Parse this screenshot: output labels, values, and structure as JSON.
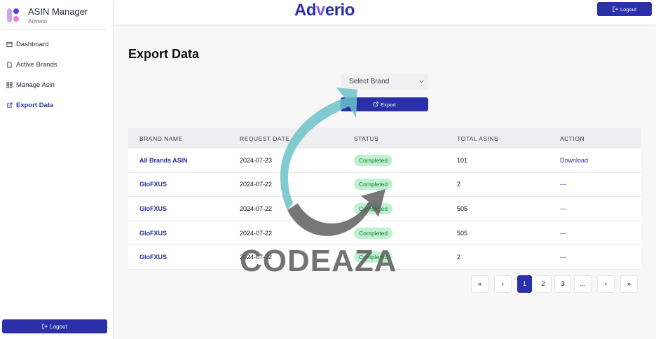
{
  "sidebar": {
    "brand_title": "ASIN Manager",
    "brand_subtitle": "Adverio",
    "items": [
      {
        "label": "Dashboard",
        "icon": "dashboard-icon"
      },
      {
        "label": "Active Brands",
        "icon": "document-icon"
      },
      {
        "label": "Manage Asin",
        "icon": "grid-icon"
      },
      {
        "label": "Export Data",
        "icon": "external-link-icon",
        "active": true
      }
    ],
    "logout_label": "Logout"
  },
  "topbar": {
    "logo_prefix": "Ad",
    "logo_v": "v",
    "logo_suffix": "erio",
    "logout_label": "Logout"
  },
  "main": {
    "title": "Export Data",
    "select_placeholder": "Select Brand",
    "export_label": "Export",
    "table": {
      "headers": [
        "BRAND NAME",
        "REQUEST DATE",
        "STATUS",
        "TOTAL ASINS",
        "ACTION"
      ],
      "rows": [
        {
          "brand": "All Brands ASIN",
          "date": "2024-07-23",
          "status": "Completed",
          "total": "101",
          "action": "Download"
        },
        {
          "brand": "GloFXUS",
          "date": "2024-07-22",
          "status": "Completed",
          "total": "2",
          "action": "---"
        },
        {
          "brand": "GloFXUS",
          "date": "2024-07-22",
          "status": "Completed",
          "total": "505",
          "action": "---"
        },
        {
          "brand": "GloFXUS",
          "date": "2024-07-22",
          "status": "Completed",
          "total": "505",
          "action": "---"
        },
        {
          "brand": "GloFXUS",
          "date": "2024-07-22",
          "status": "Completed",
          "total": "2",
          "action": "---"
        }
      ]
    },
    "pagination": {
      "first": "«",
      "prev": "‹",
      "pages": [
        "1",
        "2",
        "3",
        "..."
      ],
      "next": "›",
      "last": "»",
      "current": "1"
    }
  },
  "watermark": {
    "text": "CODEAZA"
  },
  "colors": {
    "primary": "#2b2fa8",
    "status_bg": "#bff0cf",
    "status_text": "#1b7a3b"
  }
}
